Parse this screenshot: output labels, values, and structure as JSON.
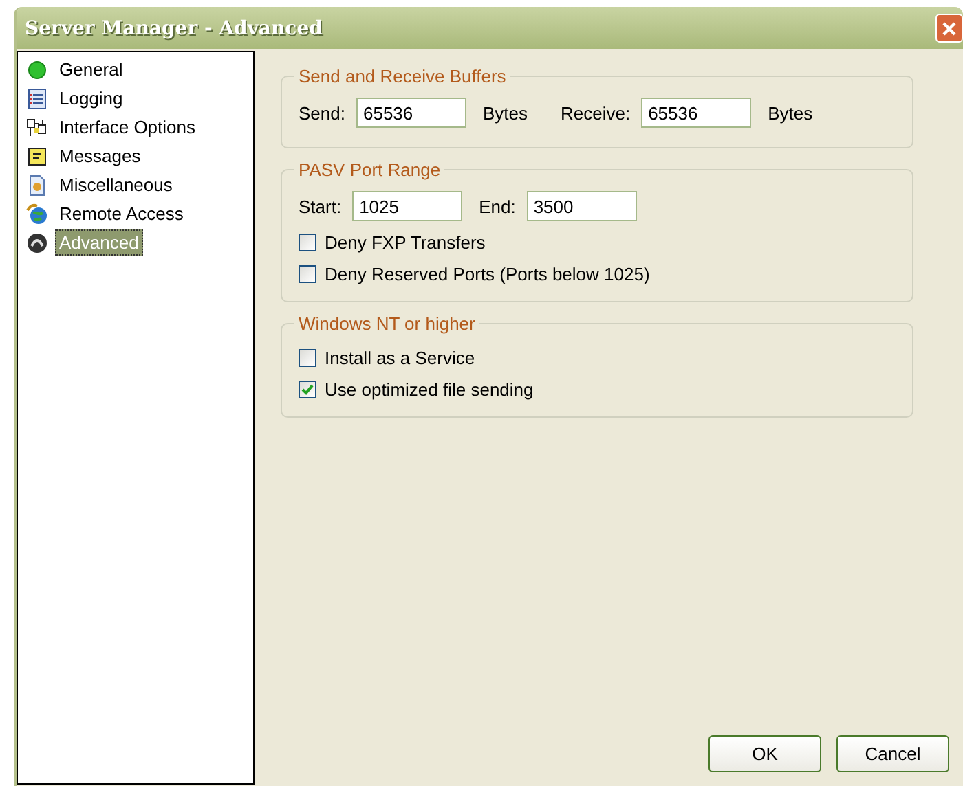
{
  "window": {
    "title": "Server Manager - Advanced"
  },
  "sidebar": {
    "items": [
      {
        "label": "General",
        "selected": false
      },
      {
        "label": "Logging",
        "selected": false
      },
      {
        "label": "Interface Options",
        "selected": false
      },
      {
        "label": "Messages",
        "selected": false
      },
      {
        "label": "Miscellaneous",
        "selected": false
      },
      {
        "label": "Remote Access",
        "selected": false
      },
      {
        "label": "Advanced",
        "selected": true
      }
    ]
  },
  "groups": [
    {
      "title": "Send and Receive Buffers",
      "fields": [
        {
          "label": "Send:",
          "value": "65536",
          "unit": "Bytes"
        },
        {
          "label": "Receive:",
          "value": "65536",
          "unit": "Bytes"
        }
      ]
    },
    {
      "title": "PASV Port Range",
      "fields": [
        {
          "label": "Start:",
          "value": "1025"
        },
        {
          "label": "End:",
          "value": "3500"
        }
      ],
      "checkboxes": [
        {
          "label": "Deny FXP Transfers",
          "checked": false
        },
        {
          "label": "Deny Reserved Ports (Ports below 1025)",
          "checked": false
        }
      ]
    },
    {
      "title": "Windows NT or higher",
      "checkboxes": [
        {
          "label": "Install as a Service",
          "checked": false
        },
        {
          "label": "Use optimized file sending",
          "checked": true
        }
      ]
    }
  ],
  "buttons": [
    "OK",
    "Cancel"
  ]
}
